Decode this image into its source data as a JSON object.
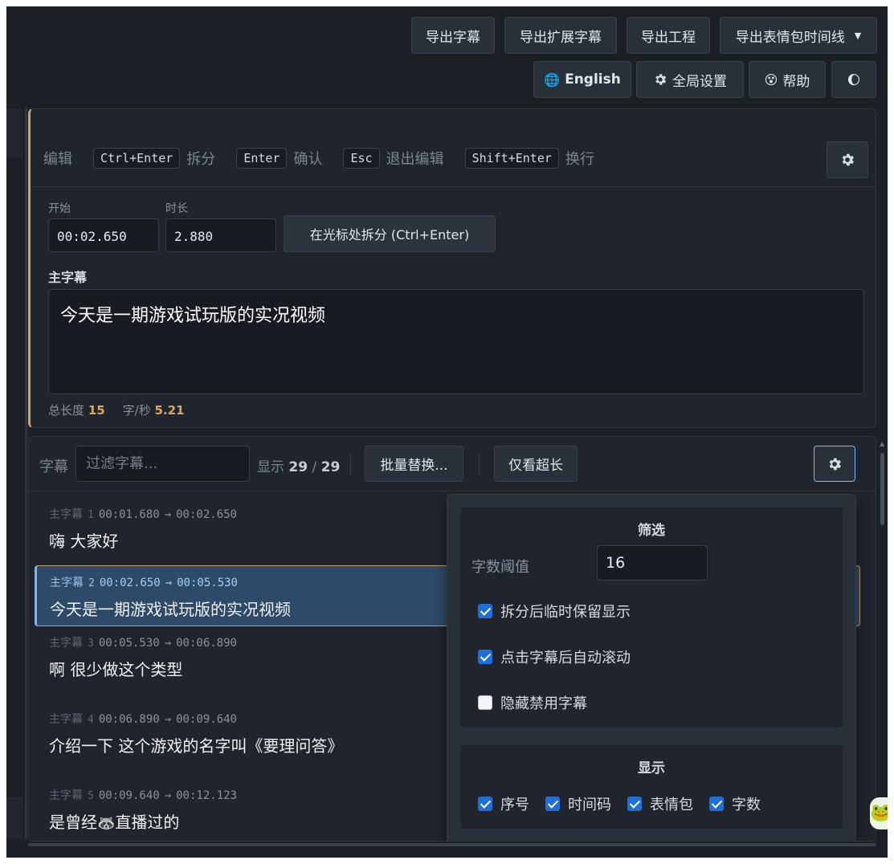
{
  "toolbar": {
    "export_subtitles": "导出字幕",
    "export_extended": "导出扩展字幕",
    "export_project": "导出工程",
    "export_emoji_timeline": "导出表情包时间线",
    "language": "English",
    "global_settings": "全局设置",
    "help": "帮助"
  },
  "editor": {
    "mode_label": "编辑",
    "shortcuts": [
      {
        "key": "Ctrl+Enter",
        "action": "拆分"
      },
      {
        "key": "Enter",
        "action": "确认"
      },
      {
        "key": "Esc",
        "action": "退出编辑"
      },
      {
        "key": "Shift+Enter",
        "action": "换行"
      }
    ],
    "start_label": "开始",
    "start_value": "00:02.650",
    "duration_label": "时长",
    "duration_value": "2.880",
    "split_button": "在光标处拆分 (Ctrl+Enter)",
    "main_subtitle_label": "主字幕",
    "main_subtitle_text": "今天是一期游戏试玩版的实况视频",
    "total_length_label": "总长度",
    "total_length_value": "15",
    "cps_label": "字/秒",
    "cps_value": "5.21"
  },
  "subtitles": {
    "label": "字幕",
    "filter_placeholder": "过滤字幕...",
    "shown_label": "显示",
    "shown_count": "29",
    "total_count": "29",
    "batch_replace": "批量替换...",
    "only_overlong": "仅看超长",
    "row_kind": "主字幕",
    "rows": [
      {
        "index": "1",
        "start": "00:01.680",
        "end": "00:02.650",
        "text": "嗨 大家好"
      },
      {
        "index": "2",
        "start": "00:02.650",
        "end": "00:05.530",
        "text": "今天是一期游戏试玩版的实况视频"
      },
      {
        "index": "3",
        "start": "00:05.530",
        "end": "00:06.890",
        "text": "啊 很少做这个类型"
      },
      {
        "index": "4",
        "start": "00:06.890",
        "end": "00:09.640",
        "text": "介绍一下 这个游戏的名字叫《要理问答》"
      },
      {
        "index": "5",
        "start": "00:09.640",
        "end": "00:12.123",
        "text_before": "是曾经",
        "text_after": "直播过的"
      }
    ]
  },
  "settings_popup": {
    "filter_title": "筛选",
    "threshold_label": "字数阈值",
    "threshold_value": "16",
    "opt_keep_after_split": "拆分后临时保留显示",
    "opt_auto_scroll": "点击字幕后自动滚动",
    "opt_hide_disabled": "隐藏禁用字幕",
    "display_title": "显示",
    "show_index": "序号",
    "show_timecode": "时间码",
    "show_emoji": "表情包",
    "show_char_count": "字数",
    "checked": {
      "keep_after_split": true,
      "auto_scroll": true,
      "hide_disabled": false,
      "index": true,
      "timecode": true,
      "emoji": true,
      "char_count": true
    }
  },
  "colors": {
    "accent_orange": "#c8a26b",
    "active_row": "#2e4a69",
    "checkbox_blue": "#1e6fd9"
  }
}
